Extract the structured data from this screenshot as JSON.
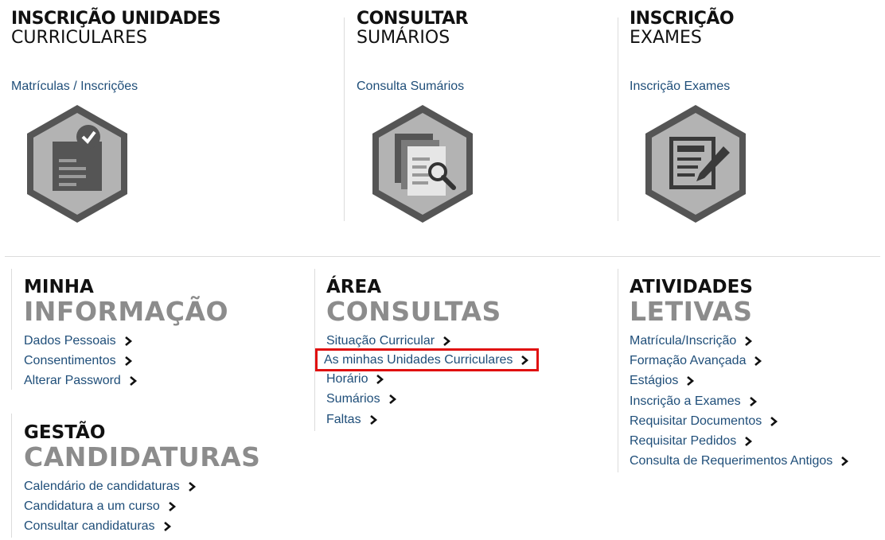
{
  "tiles": [
    {
      "title1": "INSCRIÇÃO UNIDADES",
      "title2": "CURRICULARES",
      "link": "Matrículas / Inscrições",
      "icon": "clipboard-check-icon"
    },
    {
      "title1": "CONSULTAR",
      "title2": "SUMÁRIOS",
      "link": "Consulta Sumários",
      "icon": "documents-search-icon"
    },
    {
      "title1": "INSCRIÇÃO",
      "title2": "EXAMES",
      "link": "Inscrição Exames",
      "icon": "form-pencil-icon"
    }
  ],
  "sections": {
    "minha": {
      "title1": "MINHA",
      "title2": "INFORMAÇÃO",
      "links": [
        "Dados Pessoais",
        "Consentimentos",
        "Alterar Password"
      ]
    },
    "gestao": {
      "title1": "GESTÃO",
      "title2": "CANDIDATURAS",
      "links": [
        "Calendário de candidaturas",
        "Candidatura a um curso",
        "Consultar candidaturas"
      ]
    },
    "area": {
      "title1": "ÁREA",
      "title2": "CONSULTAS",
      "links": [
        "Situação Curricular",
        "As minhas Unidades Curriculares",
        "Horário",
        "Sumários",
        "Faltas"
      ],
      "highlighted_index": 1
    },
    "atividades": {
      "title1": "ATIVIDADES",
      "title2": "LETIVAS",
      "links": [
        "Matrícula/Inscrição",
        "Formação Avançada",
        "Estágios",
        "Inscrição a Exames",
        "Requisitar Documentos",
        "Requisitar Pedidos",
        "Consulta de Requerimentos Antigos"
      ]
    }
  },
  "colors": {
    "link": "#1f4e79",
    "highlight": "#e01010",
    "hex_outer": "#555555",
    "hex_inner": "#b3b3b3",
    "muted_title": "#8c8c8c"
  }
}
